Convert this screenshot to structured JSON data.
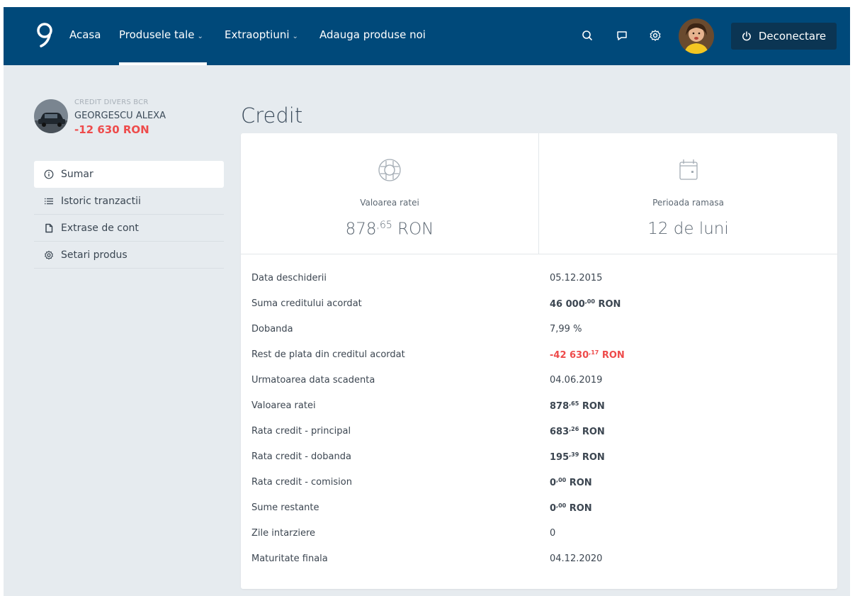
{
  "nav": {
    "items": [
      {
        "label": "Acasa"
      },
      {
        "label": "Produsele tale"
      },
      {
        "label": "Extraoptiuni"
      },
      {
        "label": "Adauga produse noi"
      }
    ],
    "logout_label": "Deconectare"
  },
  "product": {
    "kicker": "CREDIT DIVERS BCR",
    "owner": "GEORGESCU ALEXA",
    "balance": "-12 630 RON"
  },
  "sidebar": {
    "items": [
      {
        "label": "Sumar",
        "icon": "info-icon"
      },
      {
        "label": "Istoric tranzactii",
        "icon": "list-icon"
      },
      {
        "label": "Extrase de cont",
        "icon": "document-icon"
      },
      {
        "label": "Setari produs",
        "icon": "gear-icon"
      }
    ]
  },
  "page": {
    "title": "Credit"
  },
  "stats": {
    "installment": {
      "label": "Valoarea ratei",
      "int": "878",
      "dec": ",65",
      "unit": " RON"
    },
    "period": {
      "label": "Perioada ramasa",
      "value": "12 de luni"
    }
  },
  "details": [
    {
      "label": "Data deschiderii",
      "value": "05.12.2015"
    },
    {
      "label": "Suma creditului acordat",
      "int": "46 000",
      "dec": ",00",
      "unit": " RON"
    },
    {
      "label": "Dobanda",
      "value": "7,99 %"
    },
    {
      "label": "Rest de plata din creditul acordat",
      "int": "-42 630",
      "dec": ",17",
      "unit": " RON"
    },
    {
      "label": "Urmatoarea data scadenta",
      "value": "04.06.2019"
    },
    {
      "label": "Valoarea ratei",
      "int": "878",
      "dec": ",65",
      "unit": " RON"
    },
    {
      "label": "Rata credit - principal",
      "int": "683",
      "dec": ",26",
      "unit": " RON"
    },
    {
      "label": "Rata credit - dobanda",
      "int": "195",
      "dec": ",39",
      "unit": " RON"
    },
    {
      "label": "Rata credit - comision",
      "int": "0",
      "dec": ",00",
      "unit": " RON"
    },
    {
      "label": "Sume restante",
      "int": "0",
      "dec": ",00",
      "unit": " RON"
    },
    {
      "label": "Zile intarziere",
      "value": "0"
    },
    {
      "label": "Maturitate finala",
      "value": "04.12.2020"
    }
  ],
  "colors": {
    "nav": "#00497a",
    "negative": "#ee4b4b",
    "background": "#e6ebef"
  }
}
